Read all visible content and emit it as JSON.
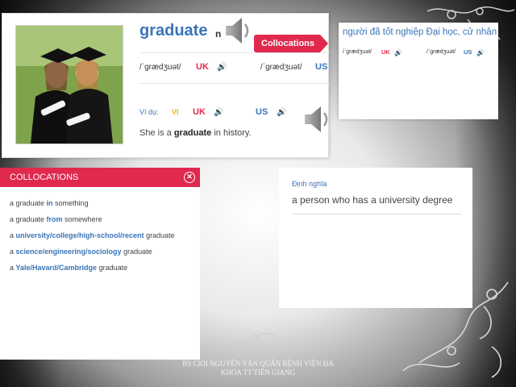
{
  "word": {
    "headword": "graduate",
    "pos": "n",
    "collocations_button": "Collocations",
    "pron_uk": "/ˈɡrædʒuət/",
    "uk_label": "UK",
    "pron_us": "/ˈɡrædʒuət/",
    "us_label": "US",
    "example_label": "Ví dụ:",
    "vi_label": "VI",
    "example_pre": "She is a ",
    "example_bold": "graduate",
    "example_post": " in history."
  },
  "translation": {
    "text": "người đã tốt nghiệp Đại học, cử nhân",
    "pron_uk": "/ˈɡrædʒuət/",
    "uk_label": "UK",
    "pron_us": "/ˈɡrædʒuət/",
    "us_label": "US"
  },
  "collocations": {
    "header": "COLLOCATIONS",
    "items": [
      {
        "pre": "a graduate ",
        "bold": "in",
        "post": " something"
      },
      {
        "pre": "a graduate ",
        "bold": "from",
        "post": " somewhere"
      },
      {
        "pre": "a ",
        "bold": "university/college/high-school/recent",
        "post": " graduate"
      },
      {
        "pre": "a ",
        "bold": "science/engineering/sociology",
        "post": " graduate"
      },
      {
        "pre": "a ",
        "bold": "Yale/Havard/Cambridge",
        "post": " graduate"
      }
    ]
  },
  "definition": {
    "label": "Định nghĩa",
    "text": "a person who has a university degree"
  },
  "footer": {
    "line1": "BS CKII NGUYỄN VĂN QUÂN BỆNH VIỆN ĐA",
    "line2": "KHOA TT TIỀN GIANG"
  },
  "colors": {
    "accent_red": "#e0294d",
    "accent_blue": "#3a74b8",
    "vi_yellow": "#e8b81c"
  },
  "icons": [
    "speaker-icon",
    "close-icon"
  ]
}
